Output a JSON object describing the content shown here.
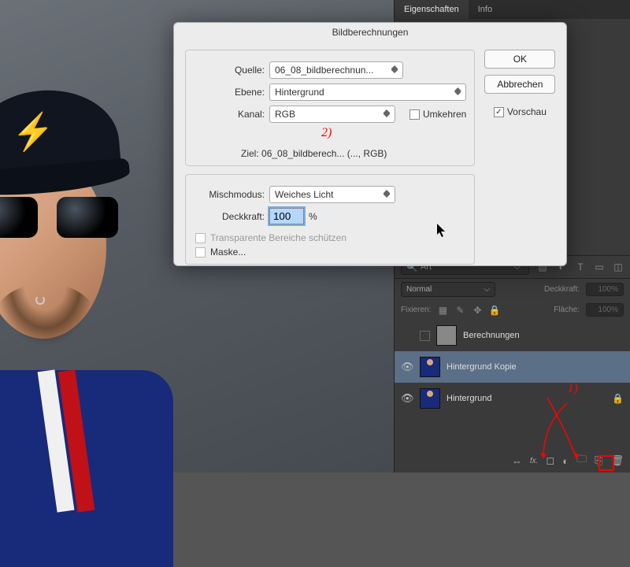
{
  "tabs": {
    "eigenschaften": "Eigenschaften",
    "info": "Info"
  },
  "dialog": {
    "title": "Bildberechnungen",
    "quelle_label": "Quelle:",
    "quelle_value": "06_08_bildberechnun...",
    "ebene_label": "Ebene:",
    "ebene_value": "Hintergrund",
    "kanal_label": "Kanal:",
    "kanal_value": "RGB",
    "umkehren": "Umkehren",
    "ziel_label": "Ziel:",
    "ziel_value": "06_08_bildberech... (..., RGB)",
    "mischmodus_label": "Mischmodus:",
    "mischmodus_value": "Weiches Licht",
    "deckkraft_label": "Deckkraft:",
    "deckkraft_value": "100",
    "deckkraft_unit": "%",
    "transparent": "Transparente Bereiche schützen",
    "maske": "Maske...",
    "ok": "OK",
    "abbrechen": "Abbrechen",
    "vorschau": "Vorschau"
  },
  "annotations": {
    "one": "1)",
    "two": "2)"
  },
  "layers": {
    "search_label": "Art",
    "blend": "Normal",
    "deckkraft_label": "Deckkraft:",
    "deckkraft_value": "100%",
    "fix_label": "Fixieren:",
    "flaeche_label": "Fläche:",
    "flaeche_value": "100%",
    "rows": [
      {
        "name": "Berechnungen"
      },
      {
        "name": "Hintergrund Kopie"
      },
      {
        "name": "Hintergrund"
      }
    ]
  }
}
